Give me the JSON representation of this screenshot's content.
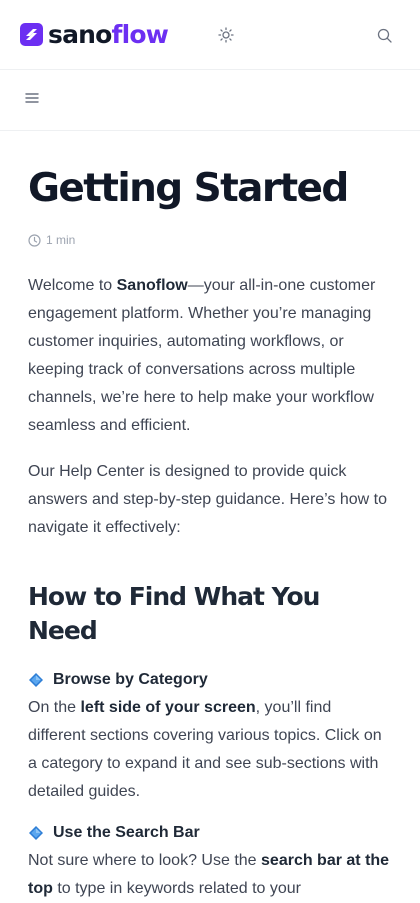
{
  "header": {
    "logo_part1": "sano",
    "logo_part2": "flow",
    "brand_color": "#6c2ff2"
  },
  "icons": {
    "theme": "sun-icon",
    "search": "search-icon",
    "menu": "hamburger-menu-icon",
    "clock": "clock-icon",
    "bullet": "blue-diamond-icon"
  },
  "article": {
    "title": "Getting Started",
    "read_time": "1 min",
    "intro": {
      "t1": "Welcome to ",
      "brand": "Sanoflow",
      "t2": "—your all-in-one customer engagement platform. Whether you’re managing customer inquiries, automating workflows, or keeping track of conversations across multiple channels, we’re here to help make your workflow seamless and efficient."
    },
    "help_center": "Our Help Center is designed to provide quick answers and step-by-step guidance. Here’s how to navigate it effectively:",
    "section_heading": "How to Find What You Need",
    "items": [
      {
        "title": "Browse by Category",
        "t1": "On the ",
        "strong": "left side of your screen",
        "t2": ", you’ll find different sections covering various topics. Click on a category to expand it and see sub-sections with detailed guides."
      },
      {
        "title": "Use the Search Bar",
        "t1": "Not sure where to look? Use the ",
        "strong": "search bar at the top",
        "t2": " to type in keywords related to your"
      }
    ]
  }
}
